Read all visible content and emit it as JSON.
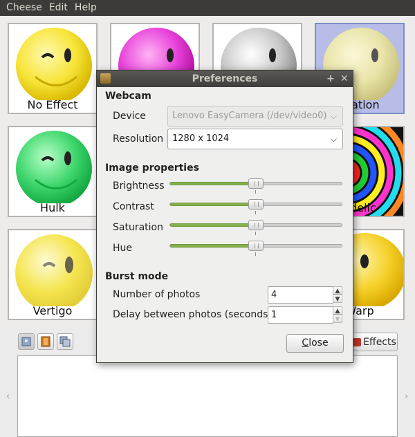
{
  "menu": [
    "Cheese",
    "Edit",
    "Help"
  ],
  "effects": [
    {
      "label": "No Effect",
      "color": "#f7e437",
      "selected": false
    },
    {
      "label": "",
      "color": "#e63fd8",
      "selected": false
    },
    {
      "label": "",
      "color": "#c8c8c8",
      "selected": false
    },
    {
      "label": "uration",
      "color": "#e8e3a7",
      "selected": true
    },
    {
      "label": "Hulk",
      "color": "#3ed66c",
      "selected": false
    },
    {
      "label": "",
      "color": "",
      "selected": false
    },
    {
      "label": "",
      "color": "",
      "selected": false
    },
    {
      "label": "edelic",
      "color": "#ff2222",
      "selected": false
    },
    {
      "label": "Vertigo",
      "color": "#f3e23c",
      "selected": false
    },
    {
      "label": "",
      "color": "",
      "selected": false
    },
    {
      "label": "",
      "color": "",
      "selected": false
    },
    {
      "label": "Warp",
      "color": "#f6d12a",
      "selected": false
    }
  ],
  "bottom": {
    "effects_label": "Effects"
  },
  "dialog": {
    "title": "Preferences",
    "webcam_heading": "Webcam",
    "device_label": "Device",
    "device_value": "Lenovo EasyCamera (/dev/video0)",
    "resolution_label": "Resolution",
    "resolution_value": "1280 x 1024",
    "image_heading": "Image properties",
    "sliders": [
      {
        "label": "Brightness",
        "value": 0.5
      },
      {
        "label": "Contrast",
        "value": 0.5
      },
      {
        "label": "Saturation",
        "value": 0.5
      },
      {
        "label": "Hue",
        "value": 0.5
      }
    ],
    "burst_heading": "Burst mode",
    "num_photos_label": "Number of photos",
    "num_photos_value": "4",
    "delay_label": "Delay between photos (seconds)",
    "delay_value": "1",
    "close_label": "Close",
    "close_accel": "C",
    "close_rest": "lose"
  }
}
